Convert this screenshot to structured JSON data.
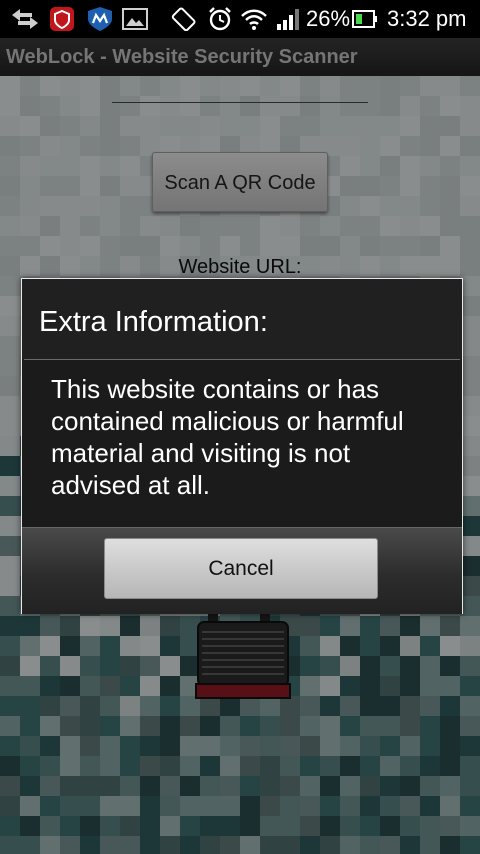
{
  "status_bar": {
    "battery_percent": "26%",
    "time": "3:32 pm",
    "icons": [
      "back-arrows-icon",
      "shield-app-icon",
      "mcafee-icon",
      "image-icon",
      "rotate-icon",
      "alarm-icon",
      "wifi-icon",
      "signal-icon",
      "battery-icon"
    ]
  },
  "app": {
    "title": "WebLock - Website Security Scanner"
  },
  "main": {
    "scan_button_label": "Scan A QR Code",
    "url_label": "Website URL:"
  },
  "dialog": {
    "title": "Extra Information:",
    "message": "This website contains or has contained malicious or harmful material and visiting is not advised at all.",
    "cancel_label": "Cancel"
  },
  "colors": {
    "dialog_bg": "#1b1b1b",
    "accent_red": "#8b1a24"
  }
}
